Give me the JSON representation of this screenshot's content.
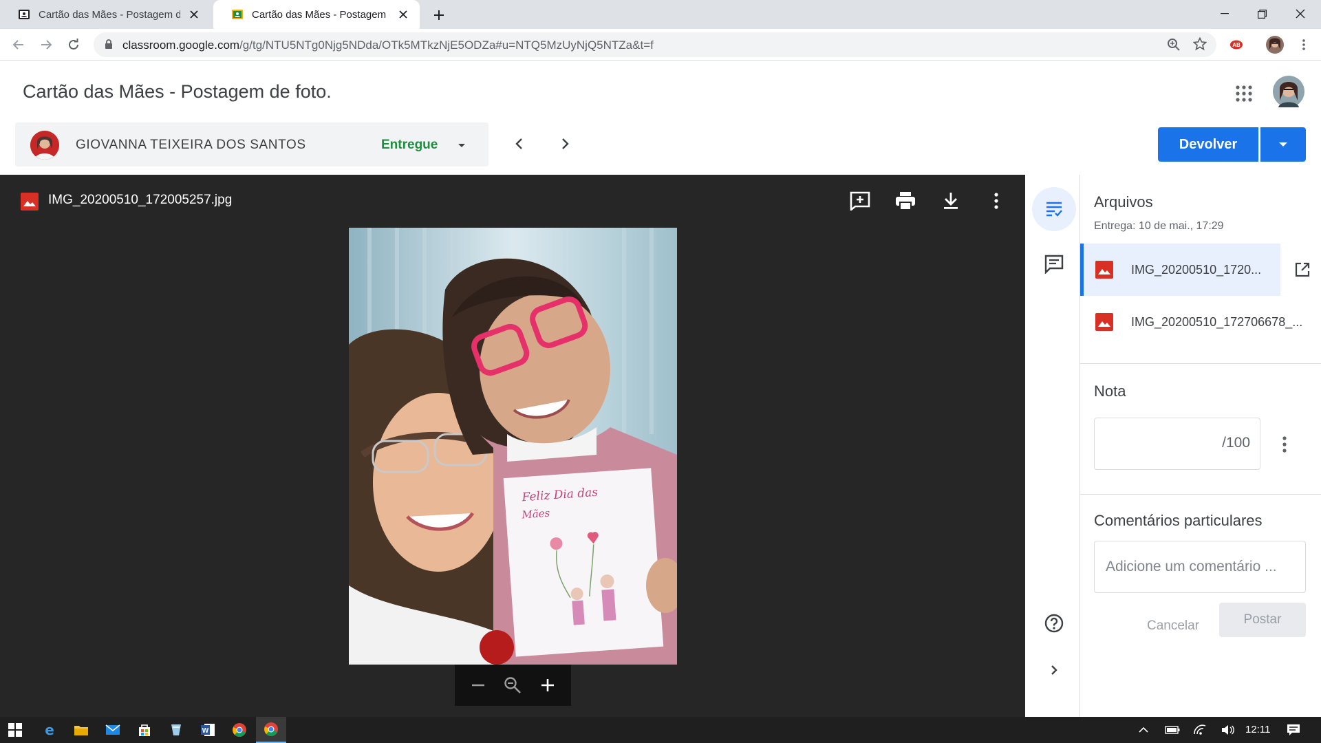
{
  "browser": {
    "tabs": [
      {
        "title": "Cartão das Mães - Postagem de f",
        "active": false
      },
      {
        "title": "Cartão das Mães - Postagem de f",
        "active": true
      }
    ],
    "url_main": "classroom.google.com",
    "url_rest": "/g/tg/NTU5NTg0Njg5NDda/OTk5MTkzNjE5ODZa#u=NTQ5MzUyNjQ5NTZa&t=f"
  },
  "header": {
    "title": "Cartão das Mães - Postagem de foto.",
    "student_name": "GIOVANNA TEIXEIRA DOS SANTOS",
    "status": "Entregue",
    "return_button": "Devolver"
  },
  "viewer": {
    "file_name": "IMG_20200510_172005257.jpg"
  },
  "panel": {
    "files_title": "Arquivos",
    "submitted": "Entrega: 10 de mai., 17:29",
    "files": [
      {
        "name": "IMG_20200510_1720..."
      },
      {
        "name": "IMG_20200510_172706678_..."
      }
    ],
    "grade_title": "Nota",
    "grade_suffix": "/100",
    "comments_title": "Comentários particulares",
    "comment_placeholder": "Adicione um comentário ...",
    "cancel": "Cancelar",
    "post": "Postar"
  },
  "taskbar": {
    "time": "12:11"
  },
  "colors": {
    "accent": "#1a73e8",
    "status_green": "#1e8e3e",
    "file_icon_red": "#d93025",
    "viewer_bg": "#262626"
  }
}
